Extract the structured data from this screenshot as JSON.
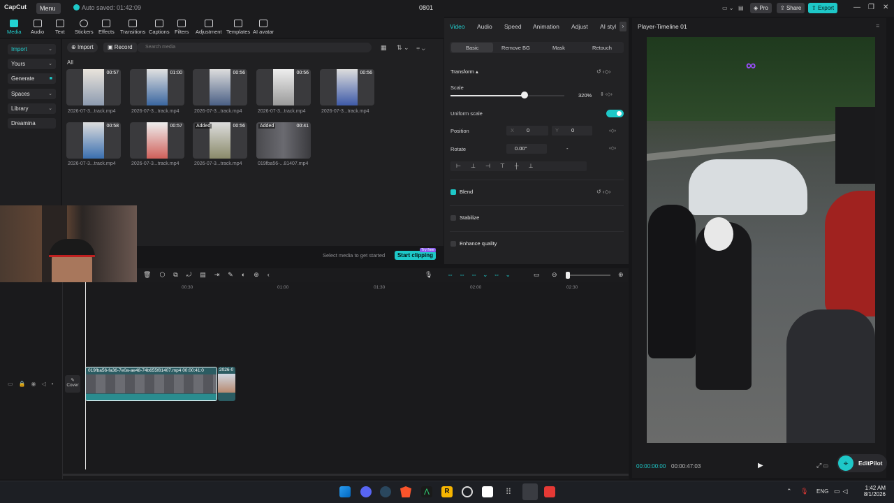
{
  "app": {
    "logo": "CapCut",
    "menu_label": "Menu",
    "autosave": "Auto saved: 01:42:09",
    "project_name": "0801",
    "pro_label": "Pro",
    "share_label": "Share",
    "export_label": "Export"
  },
  "toolbar": {
    "items": [
      "Media",
      "Audio",
      "Text",
      "Stickers",
      "Effects",
      "Transitions",
      "Captions",
      "Filters",
      "Adjustment",
      "Templates",
      "AI avatar"
    ]
  },
  "sidebar": {
    "items": [
      "Import",
      "Yours",
      "Generate",
      "Spaces",
      "Library",
      "Dreamina"
    ]
  },
  "media": {
    "import_label": "Import",
    "record_label": "Record",
    "search_placeholder": "Search media",
    "filter_all": "All",
    "items": [
      {
        "name": "2026-07-3...track.mp4",
        "duration": "00:57",
        "added": ""
      },
      {
        "name": "2026-07-3...track.mp4",
        "duration": "01:00",
        "added": ""
      },
      {
        "name": "2026-07-3...track.mp4",
        "duration": "00:56",
        "added": ""
      },
      {
        "name": "2026-07-3...track.mp4",
        "duration": "00:56",
        "added": ""
      },
      {
        "name": "2026-07-3...track.mp4",
        "duration": "00:56",
        "added": ""
      },
      {
        "name": "2026-07-3...track.mp4",
        "duration": "00:58",
        "added": ""
      },
      {
        "name": "2026-07-3...track.mp4",
        "duration": "00:57",
        "added": ""
      },
      {
        "name": "2026-07-3...track.mp4",
        "duration": "00:56",
        "added": "Added"
      },
      {
        "name": "019fba56-...81407.mp4",
        "duration": "00:41",
        "added": "Added"
      }
    ],
    "select_msg": "Select media to get started",
    "start_clipping": "Start clipping",
    "try_free": "Try free"
  },
  "props": {
    "tabs": [
      "Video",
      "Audio",
      "Speed",
      "Animation",
      "Adjust",
      "AI styl"
    ],
    "subtabs": [
      "Basic",
      "Remove BG",
      "Mask",
      "Retouch"
    ],
    "transform_label": "Transform",
    "scale_label": "Scale",
    "scale_value": "320%",
    "scale_fraction": 0.65,
    "uniform_scale_label": "Uniform scale",
    "position_label": "Position",
    "pos_x_label": "X",
    "pos_x": "0",
    "pos_y_label": "Y",
    "pos_y": "0",
    "rotate_label": "Rotate",
    "rotate_value": "0.00°",
    "rotate_extra": "-",
    "blend_label": "Blend",
    "stabilize_label": "Stabilize",
    "enhance_label": "Enhance quality"
  },
  "player": {
    "title": "Player-Timeline 01",
    "current_time": "00:00:00:00",
    "total_time": "00:00:47:03",
    "watermark": "EditPilot"
  },
  "timeline": {
    "ruler": [
      "00:30",
      "01:00",
      "01:30",
      "02:00",
      "02:30"
    ],
    "cover_label": "Cover",
    "clip1_name": "019fba56-fa36-7e0a-ae48-74b655f81407.mp4",
    "clip1_duration": "00:00:41:0",
    "clip2_name": "2026-0"
  },
  "taskbar": {
    "lang": "ENG",
    "time": "1:42 AM",
    "date": "8/1/2026"
  }
}
